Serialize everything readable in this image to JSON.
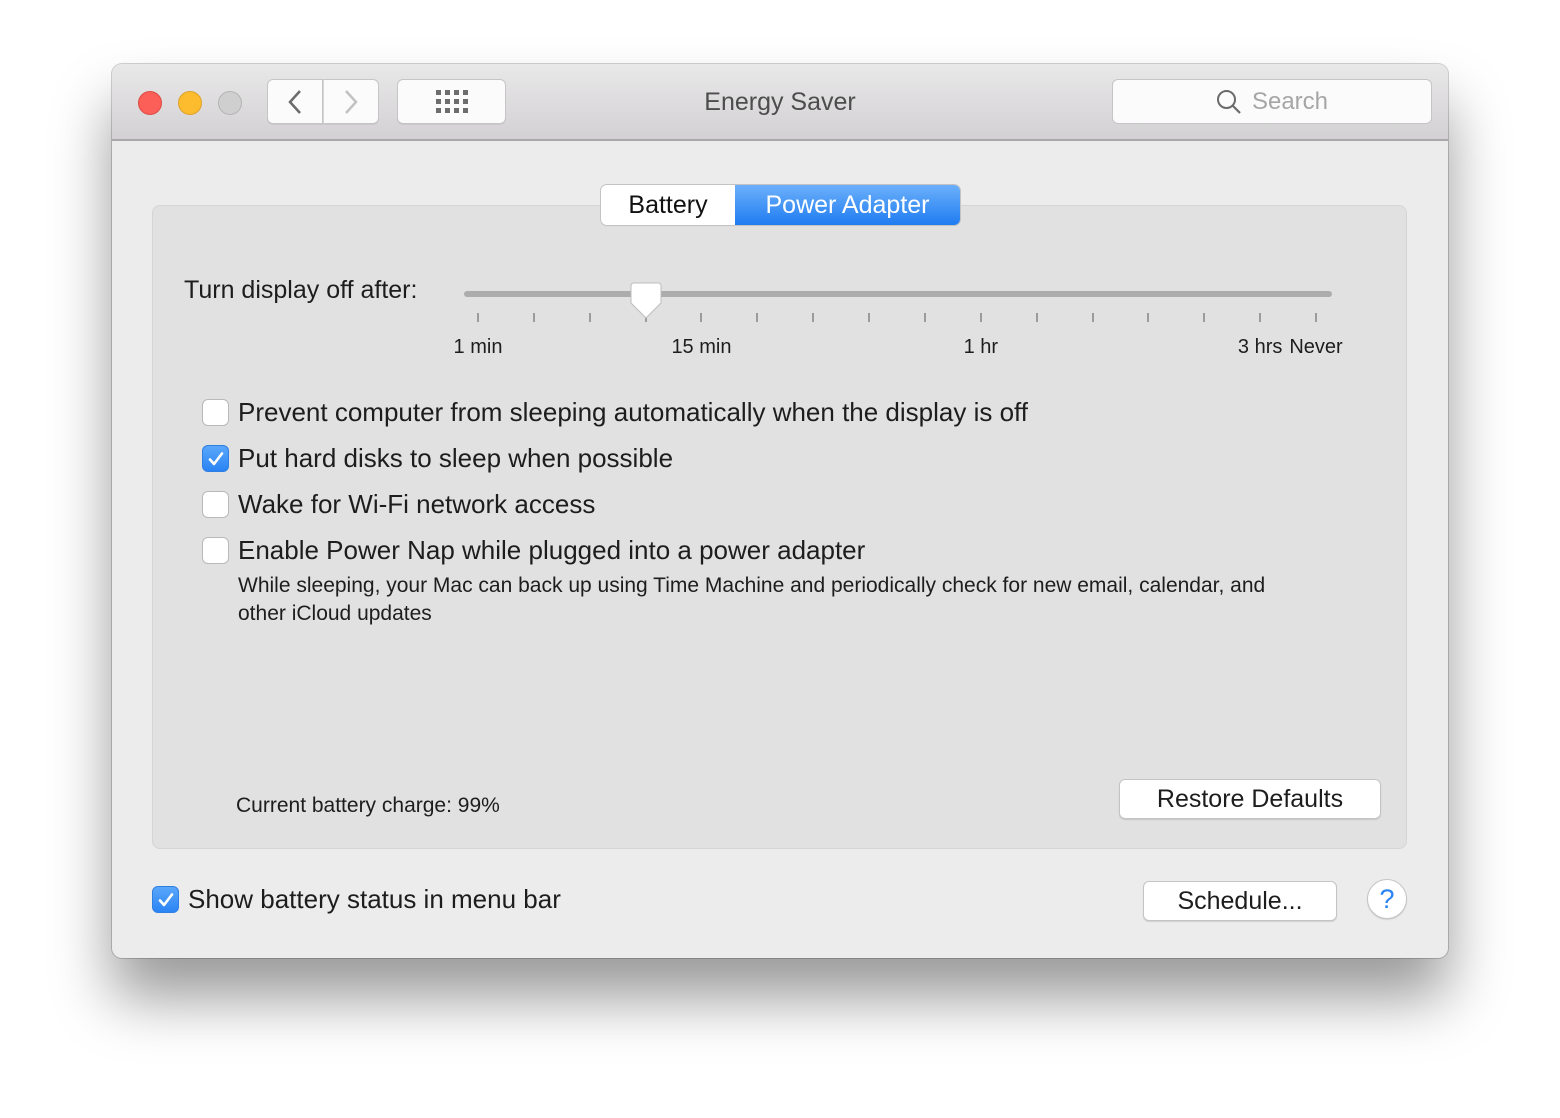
{
  "window": {
    "title": "Energy Saver",
    "traffic_lights": [
      "close",
      "minimize",
      "zoom"
    ],
    "nav": {
      "back_icon": "chevron-left-icon",
      "forward_icon": "chevron-right-icon",
      "grid_icon": "show-all-grid-icon"
    },
    "search": {
      "placeholder": "Search",
      "icon": "magnifier-icon"
    }
  },
  "tabs": [
    {
      "label": "Battery",
      "selected": false
    },
    {
      "label": "Power Adapter",
      "selected": true
    }
  ],
  "display_slider": {
    "label": "Turn display off after:",
    "tick_count": 16,
    "selected_tick_index": 3,
    "tick_labels": [
      {
        "text": "1 min",
        "tick": 0
      },
      {
        "text": "15 min",
        "tick": 4
      },
      {
        "text": "1 hr",
        "tick": 9
      },
      {
        "text": "3 hrs",
        "tick": 14
      },
      {
        "text": "Never",
        "tick": 15
      }
    ]
  },
  "options": [
    {
      "label": "Prevent computer from sleeping automatically when the display is off",
      "checked": false
    },
    {
      "label": "Put hard disks to sleep when possible",
      "checked": true
    },
    {
      "label": "Wake for Wi-Fi network access",
      "checked": false
    },
    {
      "label": "Enable Power Nap while plugged into a power adapter",
      "checked": false
    }
  ],
  "power_nap_note": "While sleeping, your Mac can back up using Time Machine and periodically check for new email, calendar, and other iCloud updates",
  "battery_charge": "Current battery charge: 99%",
  "buttons": {
    "restore_defaults": "Restore Defaults",
    "schedule": "Schedule...",
    "help": "?"
  },
  "show_status": {
    "label": "Show battery status in menu bar",
    "checked": true
  },
  "colors": {
    "accent": "#2a84f4",
    "close": "#fc5f57",
    "minimize": "#fdbc2e",
    "zoom_disabled": "#d0cfd0"
  }
}
